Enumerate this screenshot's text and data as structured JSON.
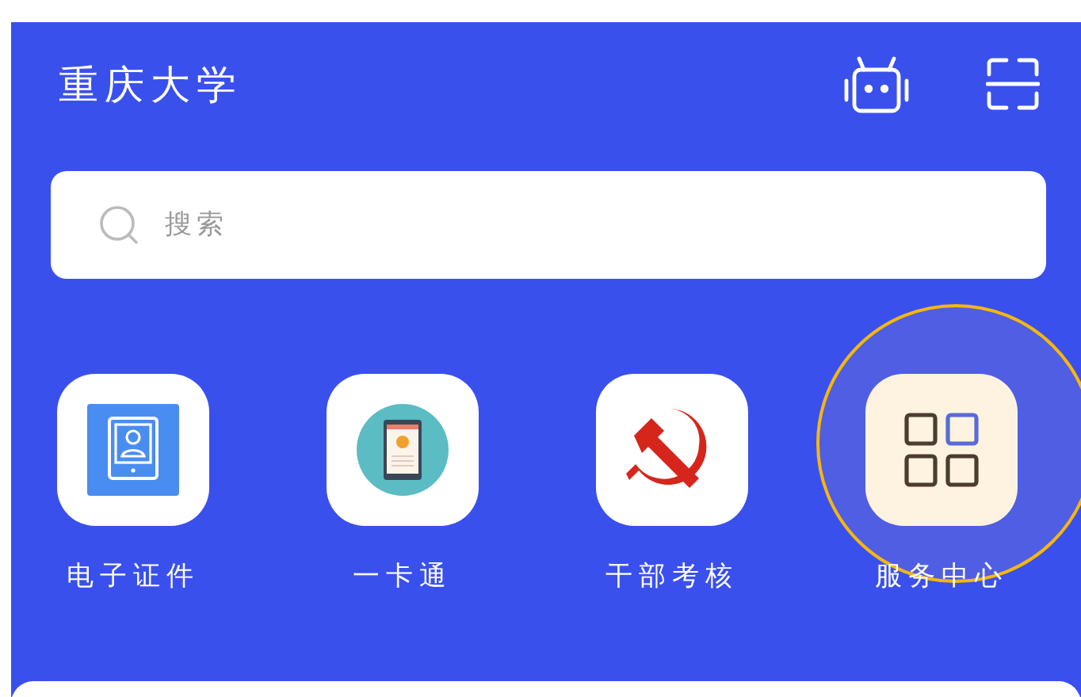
{
  "header": {
    "title": "重庆大学"
  },
  "search": {
    "placeholder": "搜索"
  },
  "shortcuts": [
    {
      "label": "电子证件",
      "kind": "id-card",
      "highlighted": false
    },
    {
      "label": "一卡通",
      "kind": "card",
      "highlighted": false
    },
    {
      "label": "干部考核",
      "kind": "party",
      "highlighted": false
    },
    {
      "label": "服务中心",
      "kind": "grid",
      "highlighted": true
    }
  ]
}
